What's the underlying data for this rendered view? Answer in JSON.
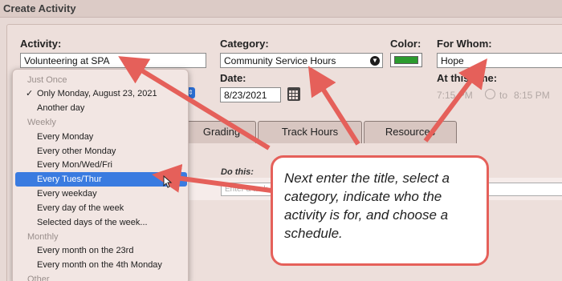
{
  "window": {
    "title": "Create Activity"
  },
  "form": {
    "activity_label": "Activity:",
    "activity_value": "Volunteering at SPA",
    "category_label": "Category:",
    "category_value": "Community Service Hours",
    "color_label": "Color:",
    "color_value": "#2b9b2e",
    "for_whom_label": "For Whom:",
    "for_whom_value": "Hope",
    "date_label": "Date:",
    "date_value": "8/23/2021",
    "at_this_time_label": "At this time:",
    "time_start": "7:15 PM",
    "time_to": "to",
    "time_end": "8:15 PM"
  },
  "tabs": [
    {
      "label": "Grading"
    },
    {
      "label": "Track Hours"
    },
    {
      "label": "Resources"
    }
  ],
  "do_this": {
    "label": "Do this:",
    "placeholder": "Enter a task"
  },
  "schedule_menu": {
    "items": [
      {
        "type": "header",
        "label": "Just Once"
      },
      {
        "type": "item",
        "label": "Only Monday, August 23, 2021",
        "checked": true
      },
      {
        "type": "item",
        "label": "Another day"
      },
      {
        "type": "header",
        "label": "Weekly"
      },
      {
        "type": "item",
        "label": "Every Monday"
      },
      {
        "type": "item",
        "label": "Every other Monday"
      },
      {
        "type": "item",
        "label": "Every Mon/Wed/Fri"
      },
      {
        "type": "item",
        "label": "Every Tues/Thur",
        "selected": true
      },
      {
        "type": "item",
        "label": "Every weekday"
      },
      {
        "type": "item",
        "label": "Every day of the week"
      },
      {
        "type": "item",
        "label": "Selected days of the week..."
      },
      {
        "type": "header",
        "label": "Monthly"
      },
      {
        "type": "item",
        "label": "Every month on the 23rd"
      },
      {
        "type": "item",
        "label": "Every month on the 4th Monday"
      },
      {
        "type": "header",
        "label": "Other"
      }
    ],
    "check_glyph": "✓"
  },
  "callout": {
    "text": "Next enter the title, select a category, indicate who the activity is for, and choose a schedule."
  },
  "colors": {
    "accent": "#e5605a",
    "selection": "#3a7be0"
  }
}
